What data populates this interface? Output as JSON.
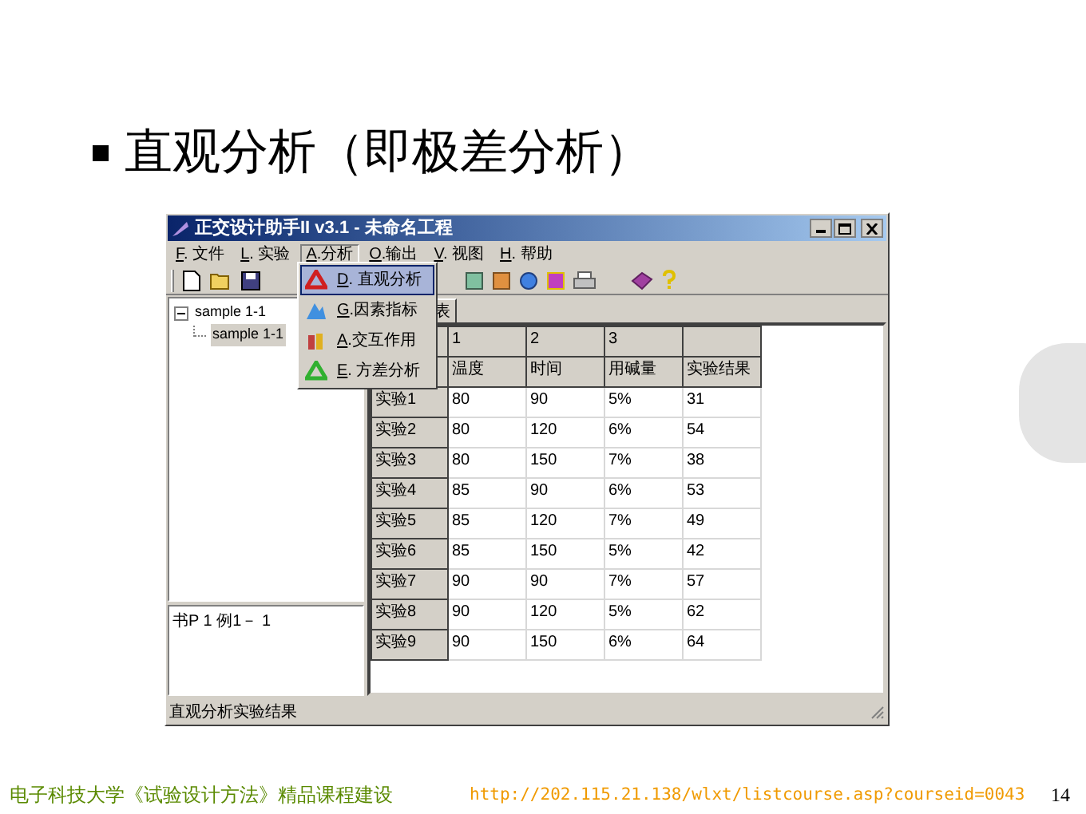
{
  "slide": {
    "heading": "直观分析（即极差分析）",
    "footer_left": "电子科技大学《试验设计方法》精品课程建设",
    "footer_url": "http://202.115.21.138/wlxt/listcourse.asp?courseid=0043",
    "page_number": "14"
  },
  "window": {
    "title": "正交设计助手II v3.1 - 未命名工程"
  },
  "menu_bar": [
    {
      "label": "F. 文件",
      "selected": false
    },
    {
      "label": "L. 实验",
      "selected": false
    },
    {
      "label": "A.分析",
      "selected": true
    },
    {
      "label": "O.输出",
      "selected": false
    },
    {
      "label": "V. 视图",
      "selected": false
    },
    {
      "label": "H. 帮助",
      "selected": false
    }
  ],
  "menu": [
    {
      "label": "D. 直观分析",
      "selected": true
    },
    {
      "label": "G.因素指标",
      "selected": false
    },
    {
      "label": "A.交互作用",
      "selected": false
    },
    {
      "label": "E. 方差分析",
      "selected": false
    }
  ],
  "tree": [
    {
      "label": "sample 1-1",
      "expanded": true,
      "children": [
        {
          "label": "sample 1-1",
          "selected": true
        }
      ]
    }
  ],
  "note": "书P 1 例1－ 1",
  "tab": {
    "label": "表"
  },
  "table": {
    "columns": [
      {
        "number": "1",
        "name": "温度"
      },
      {
        "number": "2",
        "name": "时间"
      },
      {
        "number": "3",
        "name": "用碱量"
      },
      {
        "name": "实验结果"
      }
    ],
    "rows": [
      {
        "label": "实验1",
        "cells": [
          "80",
          "90",
          "5%",
          "31"
        ]
      },
      {
        "label": "实验2",
        "cells": [
          "80",
          "120",
          "6%",
          "54"
        ]
      },
      {
        "label": "实验3",
        "cells": [
          "80",
          "150",
          "7%",
          "38"
        ]
      },
      {
        "label": "实验4",
        "cells": [
          "85",
          "90",
          "6%",
          "53"
        ]
      },
      {
        "label": "实验5",
        "cells": [
          "85",
          "120",
          "7%",
          "49"
        ]
      },
      {
        "label": "实验6",
        "cells": [
          "85",
          "150",
          "5%",
          "42"
        ]
      },
      {
        "label": "实验7",
        "cells": [
          "90",
          "90",
          "7%",
          "57"
        ]
      },
      {
        "label": "实验8",
        "cells": [
          "90",
          "120",
          "5%",
          "62"
        ]
      },
      {
        "label": "实验9",
        "cells": [
          "90",
          "150",
          "6%",
          "64"
        ]
      }
    ]
  },
  "status_bar": "直观分析实验结果"
}
